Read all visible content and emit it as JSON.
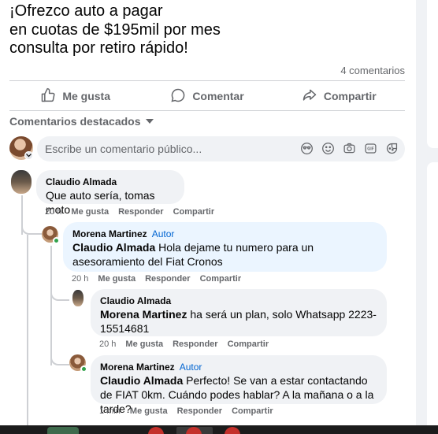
{
  "post": {
    "lines": [
      "¡Ofrezco auto a pagar",
      "en cuotas de $195mil por mes",
      "consulta por retiro rápido!"
    ],
    "comment_count": "4 comentarios"
  },
  "actions": {
    "like": "Me gusta",
    "comment": "Comentar",
    "share": "Compartir"
  },
  "featured_label": "Comentarios destacados",
  "composer": {
    "placeholder": "Escribe un comentario público..."
  },
  "comments": [
    {
      "author": "Claudio Almada",
      "text": "Que auto sería, tomas moto",
      "time": "20 h",
      "like": "Me gusta",
      "reply": "Responder",
      "share": "Compartir"
    },
    {
      "author": "Morena Martinez",
      "badge": "Autor",
      "mention": "Claudio Almada",
      "text": " Hola dejame tu numero para un asesoramiento del Fiat Cronos",
      "time": "20 h",
      "like": "Me gusta",
      "reply": "Responder",
      "share": "Compartir"
    },
    {
      "author": "Claudio Almada",
      "mention": "Morena Martinez",
      "text": " ha será un plan, solo Whatsapp 2223-15514681",
      "time": "20 h",
      "like": "Me gusta",
      "reply": "Responder",
      "share": "Compartir"
    },
    {
      "author": "Morena Martinez",
      "badge": "Autor",
      "mention": "Claudio Almada",
      "text": " Perfecto! Se van a estar contactando de FIAT 0km. Cuándo podes hablar? A la mañana o a la tarde?",
      "time": "1 min",
      "like": "Me gusta",
      "reply": "Responder",
      "share": "Compartir"
    }
  ],
  "colors": {
    "secondary_text": "#65676b",
    "bubble": "#f0f2f5",
    "bubble_highlight": "#ebf5ff",
    "author_badge": "#0064d1",
    "online": "#31a24c"
  }
}
